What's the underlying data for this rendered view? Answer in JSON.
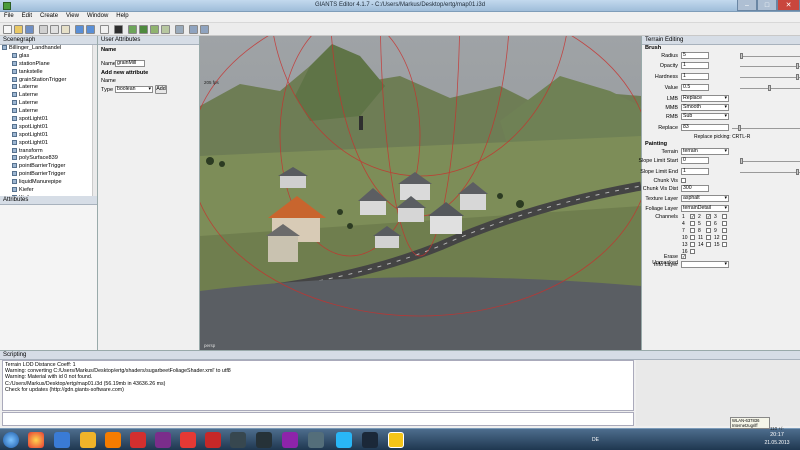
{
  "window": {
    "title": "GIANTS Editor 4.1.7 - C:/Users/Markus/Desktop/ertg/map01.i3d"
  },
  "menu": [
    "File",
    "Edit",
    "Create",
    "View",
    "Window",
    "Help"
  ],
  "scenegraph": {
    "title": "Scenegraph",
    "items": [
      {
        "label": "Billinger_Landhandel",
        "level": 0
      },
      {
        "label": "glas",
        "level": 1
      },
      {
        "label": "stationPlane",
        "level": 1
      },
      {
        "label": "tankstelle",
        "level": 1
      },
      {
        "label": "grainStationTrigger",
        "level": 1
      },
      {
        "label": "Laterne",
        "level": 1
      },
      {
        "label": "Laterne",
        "level": 1
      },
      {
        "label": "Laterne",
        "level": 1
      },
      {
        "label": "Laterne",
        "level": 1
      },
      {
        "label": "spotLight01",
        "level": 1
      },
      {
        "label": "spotLight01",
        "level": 1
      },
      {
        "label": "spotLight01",
        "level": 1
      },
      {
        "label": "spotLight01",
        "level": 1
      },
      {
        "label": "transform",
        "level": 1
      },
      {
        "label": "polySurface839",
        "level": 1
      },
      {
        "label": "pointBarrierTrigger",
        "level": 1
      },
      {
        "label": "pointBarrierTrigger",
        "level": 1
      },
      {
        "label": "liquidManurepipe",
        "level": 1
      },
      {
        "label": "Kiefer",
        "level": 1
      },
      {
        "label": "Kiefer",
        "level": 1
      }
    ]
  },
  "attributes": {
    "title": "Attributes"
  },
  "user_attributes": {
    "title": "User Attributes",
    "name_header": "Name",
    "name_label": "Name",
    "name_value": "grainMill",
    "add_header": "Add new attribute",
    "new_name_label": "Name",
    "type_label": "Type",
    "type_value": "boolean",
    "add_button": "Add"
  },
  "viewport": {
    "fps_label": "205 fps",
    "bottom_label": "persp"
  },
  "terrain_editing": {
    "title": "Terrain Editing",
    "brush_header": "Brush",
    "radius_label": "Radius",
    "radius_value": "5",
    "opacity_label": "Opacity",
    "opacity_value": "1",
    "hardness_label": "Hardness",
    "hardness_value": "1",
    "value_label": "Value",
    "value_value": "0.5",
    "lmb_label": "LMB",
    "lmb_value": "Replace",
    "mmb_label": "MMB",
    "mmb_value": "Smooth",
    "rmb_label": "RMB",
    "rmb_value": "Sub",
    "replace_label": "Replace",
    "replace_value": "83",
    "replace_picking": "Replace picking: CRTL-R",
    "painting_header": "Painting",
    "terrain_label": "Terrain",
    "terrain_value": "terrain",
    "slope_start_label": "Slope Limit Start",
    "slope_start_value": "0",
    "slope_end_label": "Slope Limit End",
    "slope_end_value": "1",
    "chunk_vis_label": "Chunk Vis",
    "chunk_vis_dist_label": "Chunk Vis Dist",
    "chunk_vis_dist_value": "300",
    "texture_layer_label": "Texture Layer",
    "texture_layer_value": "asphalt",
    "foliage_layer_label": "Foliage Layer",
    "foliage_layer_value": "terrainDetail",
    "channels_label": "Channels",
    "channels": [
      "1",
      "2",
      "3",
      "4",
      "5",
      "6",
      "7",
      "8",
      "9",
      "10",
      "11",
      "12",
      "13",
      "14",
      "15",
      "16"
    ],
    "channels_checked": [
      1,
      2
    ],
    "erase_unmasked_label": "Erase Unmasked",
    "info_layer_label": "Info Layer",
    "info_layer_value": ""
  },
  "scripting": {
    "title": "Scripting",
    "lines": [
      "Terrain LOD Distance Coeff: 1",
      "Warning: converting C:/Users/Markus/Desktop/ertg/shaders/sugarbeetFoliageShader.xml' to utf8",
      "Warning: Material with id 0 not found.",
      "C:/Users/Markus/Desktop/ertg/map01.i3d (56.19mb in 43636.26 ms)",
      "Check for updates (http://gdn.giants-software.com)"
    ]
  },
  "taskbar": {
    "language": "DE",
    "time": "20:17",
    "date": "21.05.2013",
    "network_tooltip": "WLAN-637836\nInternetzugriff",
    "zoom": "110 +/-"
  }
}
